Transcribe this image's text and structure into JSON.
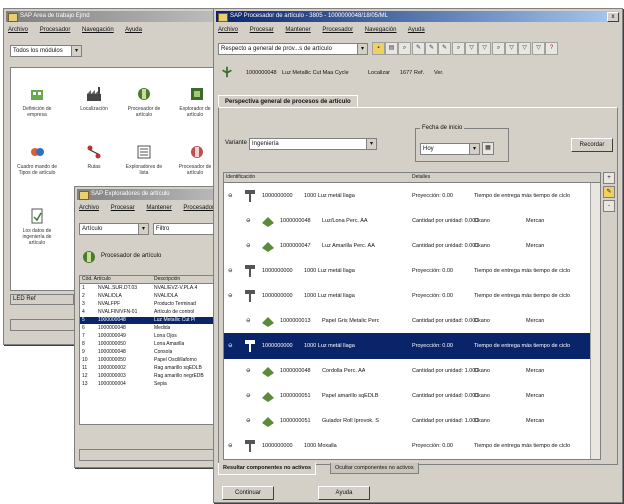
{
  "back_window": {
    "title": "SAP Area de trabajo Ejmd",
    "menu": [
      "Archivo",
      "Procesador",
      "Navegación",
      "Ayuda"
    ],
    "selector": "Todos los módulos",
    "icons": [
      {
        "label": "Definición de empresa"
      },
      {
        "label": "Localización"
      },
      {
        "label": "Procesador de artículo"
      },
      {
        "label": "Explorador de artículo"
      },
      {
        "label": "Cuadro mando de Tipos de artículo"
      },
      {
        "label": "Rutas"
      },
      {
        "label": "Exploradores de lista"
      },
      {
        "label": "Procesador de artículo"
      },
      {
        "label": "Los datos de ingeniería de artículo"
      }
    ],
    "status": "LED Ref"
  },
  "mid_window": {
    "title": "SAP Exploradores de artículo",
    "menu": [
      "Archivo",
      "Procesar",
      "Mantener",
      "Procesador"
    ],
    "filter_left": "Artículo",
    "filter_right": "Filtro",
    "header_label": "Procesador de artículo",
    "columns": [
      "Cód. Artículo",
      "Descripción"
    ],
    "rows": [
      [
        "1",
        "NVAL.SUR.DT.03",
        "NVAL/EVZ-V.PLA.4"
      ],
      [
        "2",
        "NVAL/DLA",
        "NVAL/DLA"
      ],
      [
        "3",
        "NVALFPF",
        "Producto Terminad"
      ],
      [
        "4",
        "NVALFIN/VFN-01",
        "Artículo de control"
      ],
      [
        "5",
        "1000000048",
        "Luz Metallic Cut Pl"
      ],
      [
        "6",
        "1000000048",
        "Medida"
      ],
      [
        "7",
        "1000000049",
        "Lona Ojos"
      ],
      [
        "8",
        "1000000050",
        "Lona Amarilla"
      ],
      [
        "9",
        "1000000048",
        "Consola"
      ],
      [
        "10",
        "1000000050",
        "Papel Oscilillaforno"
      ],
      [
        "11",
        "1000000002",
        "Rag amarillo sqEDLB"
      ],
      [
        "12",
        "1000000003",
        "Rag amarillo negrEDB"
      ],
      [
        "13",
        "1000000004",
        "Sepia"
      ]
    ],
    "selected_row": 4
  },
  "main_window": {
    "title": "SAP Procesador de artículo - 3805 - 1000000048/18/05/ML",
    "menu": [
      "Archivo",
      "Procesar",
      "Mantener",
      "Procesador",
      "Navegación",
      "Ayuda"
    ],
    "view_selector": "Respecto a general de prov...s de artículo",
    "info": {
      "code": "1000000048",
      "desc": "Luz Metallic Cut Maa Cycle",
      "loc_label": "Localizar",
      "loc": "1677",
      "ref": "Ref.",
      "extra": "Ver."
    },
    "tab_label": "Perspectiva general de procesos de artículo",
    "variant_label": "Variante",
    "variant_value": "Ingeniería",
    "date_label": "Fecha de inicio",
    "date_value": "Hoy",
    "refresh_button": "Recordar",
    "grid_columns": [
      "Identificación",
      "Detalles"
    ],
    "tree_rows": [
      {
        "indent": 0,
        "code": "1000000000",
        "desc": "1000 Luz metál llaga",
        "col3": "Proyección: 0.00",
        "col4": "Tiempo de entrega más tiempo de ciclo",
        "col5": "",
        "col6": "",
        "selected": false
      },
      {
        "indent": 1,
        "code": "1000000048",
        "desc": "Luz/Lona Perc. AA",
        "col3": "Cantidad por unidad: 0.000",
        "col4": "Ckano",
        "col5": "Mercan",
        "col6": "",
        "selected": false
      },
      {
        "indent": 1,
        "code": "1000000047",
        "desc": "Luz Amarilla Perc. AA",
        "col3": "Cantidad por unidad: 0.000",
        "col4": "Ckano",
        "col5": "Mercan",
        "col6": "",
        "selected": false
      },
      {
        "indent": 0,
        "code": "1000000000",
        "desc": "1000 Luz metál llaga",
        "col3": "Proyección: 0.00",
        "col4": "Tiempo de entrega más tiempo de ciclo",
        "col5": "",
        "col6": "",
        "selected": false
      },
      {
        "indent": 0,
        "code": "1000000000",
        "desc": "1000 Luz metál llaga",
        "col3": "Proyección: 0.00",
        "col4": "Tiempo de entrega más tiempo de ciclo",
        "col5": "",
        "col6": "",
        "selected": false
      },
      {
        "indent": 1,
        "code": "1000000013",
        "desc": "Papel Gris Metalic Perc",
        "col3": "Cantidad por unidad: 0.000",
        "col4": "Ckano",
        "col5": "Mercan",
        "col6": "",
        "selected": false
      },
      {
        "indent": 0,
        "code": "1000000000",
        "desc": "1000 Luz metál llaga",
        "col3": "Proyección: 0.00",
        "col4": "Tiempo de entrega más tiempo de ciclo",
        "col5": "",
        "col6": "",
        "selected": true
      },
      {
        "indent": 1,
        "code": "1000000048",
        "desc": "Cordolla Perc. AA",
        "col3": "Cantidad por unidad: 1.000",
        "col4": "Ckano",
        "col5": "Mercan",
        "col6": "",
        "selected": false
      },
      {
        "indent": 1,
        "code": "1000000051",
        "desc": "Papel amarillo sqEDLB",
        "col3": "Cantidad por unidad: 0.000",
        "col4": "Ckano",
        "col5": "Mercan",
        "col6": "",
        "selected": false
      },
      {
        "indent": 1,
        "code": "1000000051",
        "desc": "Guiador Roll Iprovok. S",
        "col3": "Cantidad por unidad: 1.000",
        "col4": "Ckano",
        "col5": "Mercan",
        "col6": "",
        "selected": false
      },
      {
        "indent": 0,
        "code": "1000000000",
        "desc": "1000 Moxalla",
        "col3": "Proyección: 0.00",
        "col4": "Tiempo de entrega más tiempo de ciclo",
        "col5": "",
        "col6": "",
        "selected": false
      }
    ],
    "bottom_tabs": [
      "Resultar componentes no activos",
      "Ocultar componentes no activos"
    ],
    "buttons": {
      "ok": "Continuar",
      "help": "Ayuda"
    },
    "toolbar_icons": [
      "save",
      "print",
      "find",
      "edit",
      "edit",
      "edit",
      "find",
      "filter",
      "filter",
      "find",
      "filter",
      "filter",
      "filter",
      "help"
    ]
  },
  "colors": {
    "title_active": "#0a246a",
    "title_inactive": "#808080",
    "selection": "#0a246a",
    "face": "#d4d0c8"
  }
}
